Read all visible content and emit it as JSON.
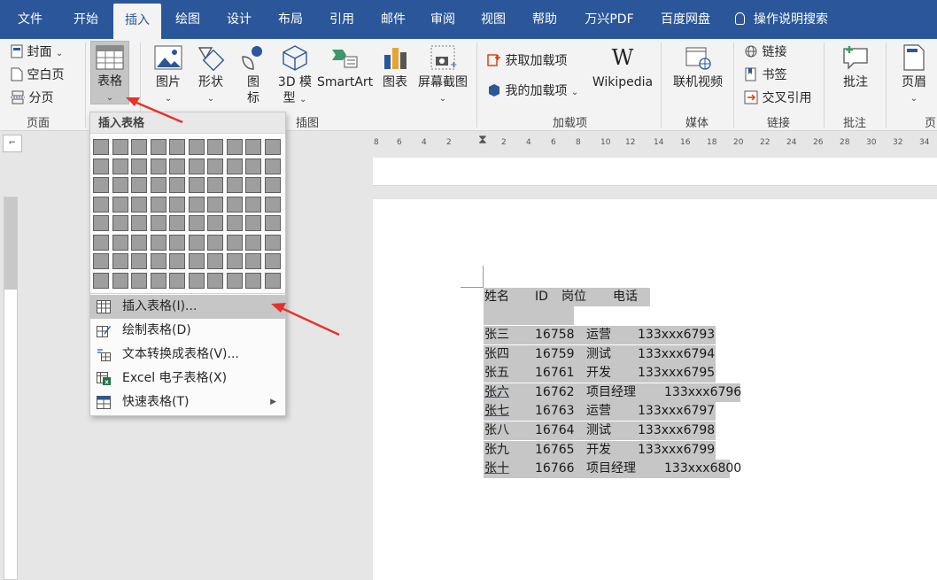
{
  "tabs": [
    "文件",
    "开始",
    "插入",
    "绘图",
    "设计",
    "布局",
    "引用",
    "邮件",
    "审阅",
    "视图",
    "帮助",
    "万兴PDF",
    "百度网盘"
  ],
  "active_tab": "插入",
  "tell_me": "操作说明搜索",
  "ribbon": {
    "pages": {
      "cover": "封面",
      "blank": "空白页",
      "break": "分页",
      "label": "页面"
    },
    "tables": {
      "table": "表格"
    },
    "illustrations": {
      "picture": "图片",
      "shapes": "形状",
      "icons1": "图",
      "icons2": "标",
      "model1": "3D 模",
      "model2": "型",
      "smartart": "SmartArt",
      "chart": "图表",
      "screenshot": "屏幕截图",
      "label": "插图"
    },
    "addins": {
      "get": "获取加载项",
      "my": "我的加载项",
      "wiki": "Wikipedia",
      "label": "加载项"
    },
    "media": {
      "video": "联机视频",
      "label": "媒体"
    },
    "links": {
      "link": "链接",
      "bookmark": "书签",
      "crossref": "交叉引用",
      "label": "链接"
    },
    "comments": {
      "comment": "批注",
      "label": "批注"
    },
    "header": {
      "header": "页眉",
      "label": "页"
    }
  },
  "dropdown": {
    "title": "插入表格",
    "grid": {
      "cols": 10,
      "rows": 8
    },
    "items": [
      {
        "label": "插入表格(I)...",
        "icon": "table-icon"
      },
      {
        "label": "绘制表格(D)",
        "icon": "pencil-table-icon"
      },
      {
        "label": "文本转换成表格(V)...",
        "icon": "text-to-table-icon"
      },
      {
        "label": "Excel 电子表格(X)",
        "icon": "excel-icon"
      },
      {
        "label": "快速表格(T)",
        "icon": "quick-table-icon"
      }
    ]
  },
  "document": {
    "header": {
      "name": "姓名",
      "id": "ID",
      "post": "岗位",
      "phone": "电话"
    },
    "rows": [
      {
        "name": "张三",
        "id": "16758",
        "post": "运营",
        "phone": "133xxx6793"
      },
      {
        "name": "张四",
        "id": "16759",
        "post": "测试",
        "phone": "133xxx6794"
      },
      {
        "name": "张五",
        "id": "16761",
        "post": "开发",
        "phone": "133xxx6795"
      },
      {
        "name": "张六",
        "id": "16762",
        "post": "项目经理",
        "phone": "133xxx6796"
      },
      {
        "name": "张七",
        "id": "16763",
        "post": "运营",
        "phone": "133xxx6797"
      },
      {
        "name": "张八",
        "id": "16764",
        "post": "测试",
        "phone": "133xxx6798"
      },
      {
        "name": "张九",
        "id": "16765",
        "post": "开发",
        "phone": "133xxx6799"
      },
      {
        "name": "张十",
        "id": "16766",
        "post": "项目经理",
        "phone": "133xxx6800"
      }
    ]
  },
  "ruler_ticks": [
    "8",
    "6",
    "4",
    "2",
    "2",
    "4",
    "6",
    "8",
    "10",
    "12",
    "14",
    "16",
    "18",
    "20",
    "22",
    "24",
    "26",
    "28",
    "30",
    "32",
    "34"
  ],
  "colors": {
    "accent": "#2b579a",
    "selection": "#c6c6c6",
    "arrow": "#e8312a"
  }
}
